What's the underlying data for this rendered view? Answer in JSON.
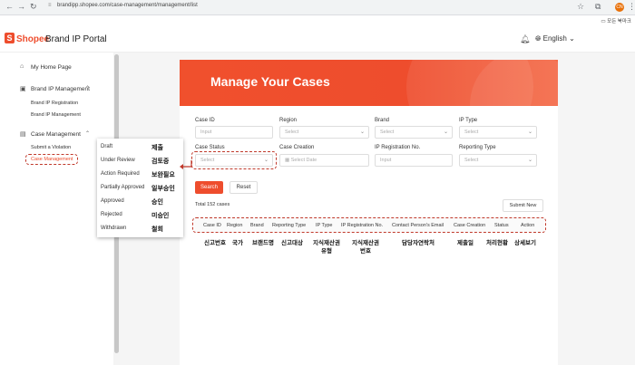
{
  "browser": {
    "url": "brandipp.shopee.com/case-management/management/list",
    "bookmark": "모든 북마크"
  },
  "app": {
    "logo": "Shopee",
    "portal_title": "Brand IP Portal",
    "language": "English"
  },
  "sidebar": {
    "home": "My Home Page",
    "brand_ip": "Brand IP Management",
    "brand_ip_registration": "Brand IP Registration",
    "brand_ip_management": "Brand IP Management",
    "case_management": "Case Management",
    "submit_violation": "Submit a Violation",
    "case_management_sub": "Case Management"
  },
  "hero": {
    "title": "Manage Your Cases"
  },
  "filters": {
    "case_id": {
      "label": "Case ID",
      "placeholder": "Input"
    },
    "region": {
      "label": "Region",
      "placeholder": "Select"
    },
    "brand": {
      "label": "Brand",
      "placeholder": "Select"
    },
    "ip_type": {
      "label": "IP Type",
      "placeholder": "Select"
    },
    "case_status": {
      "label": "Case Status",
      "placeholder": "Select"
    },
    "case_creation": {
      "label": "Case Creation",
      "placeholder": "Select Date"
    },
    "ip_registration_no": {
      "label": "IP Registration No.",
      "placeholder": "Input"
    },
    "reporting_type": {
      "label": "Reporting Type",
      "placeholder": "Select"
    }
  },
  "buttons": {
    "search": "Search",
    "reset": "Reset",
    "submit_new": "Submit New"
  },
  "total": "Total 152 cases",
  "table": {
    "columns": [
      "Case ID",
      "Region",
      "Brand",
      "Reporting Type",
      "IP Type",
      "IP Registration No.",
      "Contact Person's Email",
      "Case Creation",
      "Status",
      "Action"
    ]
  },
  "korean_headers": [
    "신고번호",
    "국가",
    "브랜드명",
    "신고대상",
    "지식재산권\n유형",
    "지식재산권\n번호",
    "담당자연락처",
    "제출일",
    "처리현황",
    "상세보기"
  ],
  "status_popup": [
    {
      "en": "Draft",
      "ko": "제출"
    },
    {
      "en": "Under Review",
      "ko": "검토중"
    },
    {
      "en": "Action Required",
      "ko": "보완필요"
    },
    {
      "en": "Partially Approved",
      "ko": "일부승인"
    },
    {
      "en": "Approved",
      "ko": "승인"
    },
    {
      "en": "Rejected",
      "ko": "미승인"
    },
    {
      "en": "Withdrawn",
      "ko": "철회"
    }
  ],
  "colors": {
    "brand": "#ee4d2d",
    "annotation": "#c0392b"
  }
}
